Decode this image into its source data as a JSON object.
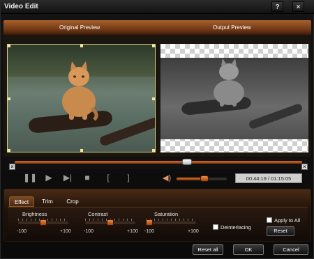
{
  "window": {
    "title": "Video Edit",
    "help_glyph": "?",
    "close_glyph": "×"
  },
  "preview": {
    "original_label": "Original Preview",
    "output_label": "Output Preview"
  },
  "playback": {
    "position_fraction": 0.6,
    "volume_fraction": 0.55,
    "timecode": "00:44:19 / 01:15:05",
    "icons": [
      "pause-icon",
      "play-icon",
      "next-frame-icon",
      "stop-icon",
      "mark-in-icon",
      "mark-out-icon",
      "volume-icon"
    ],
    "glyphs": {
      "pause": "❚❚",
      "play": "▶",
      "next_frame": "▶|",
      "stop": "■",
      "mark_in": "[",
      "mark_out": "]",
      "volume": "◀)"
    },
    "trim_marker_glyph": "×"
  },
  "tabs": [
    {
      "label": "Effect",
      "active": true
    },
    {
      "label": "Trim",
      "active": false
    },
    {
      "label": "Crop",
      "active": false
    }
  ],
  "effect": {
    "sliders": [
      {
        "label": "Brightness",
        "min": "-100",
        "max": "+100",
        "value": 0
      },
      {
        "label": "Contrast",
        "min": "-100",
        "max": "+100",
        "value": 0
      },
      {
        "label": "Saturation",
        "min": "-100",
        "max": "+100",
        "value": -100
      }
    ],
    "deinterlacing_label": "Deinterlacing",
    "apply_to_all_label": "Apply to All",
    "reset_label": "Reset"
  },
  "footer": {
    "reset_all_label": "Reset all",
    "ok_label": "OK",
    "cancel_label": "Cancel"
  },
  "colors": {
    "accent": "#d66b29",
    "header_brown": "#6a3414",
    "crop_handle": "#d8d47c"
  }
}
